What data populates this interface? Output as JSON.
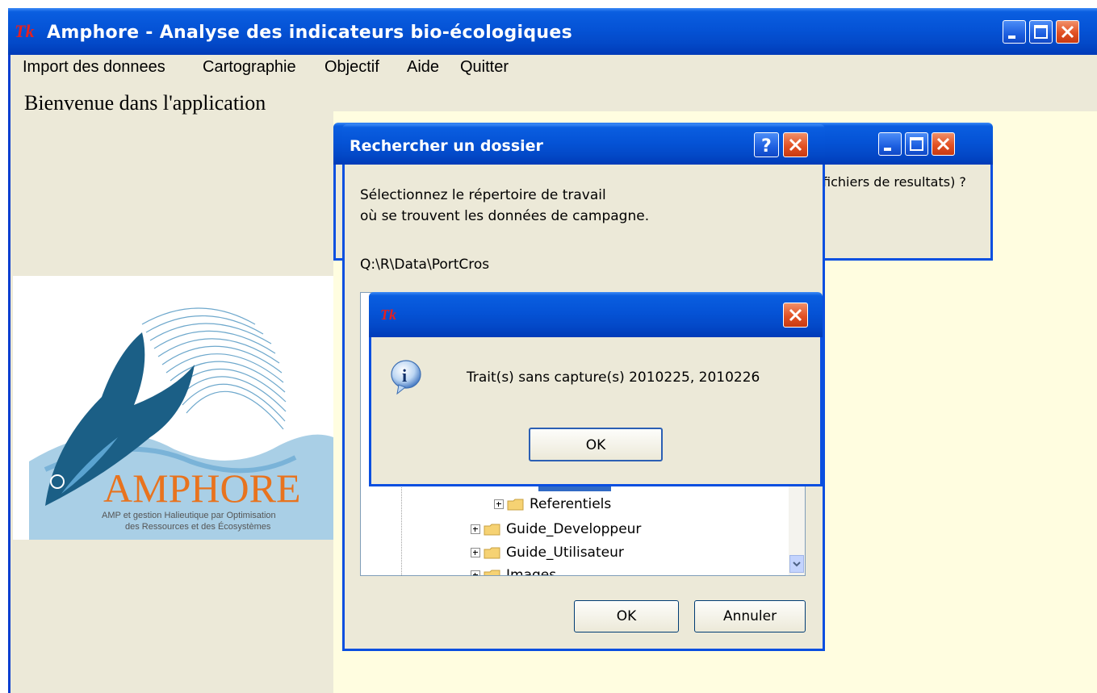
{
  "main_window": {
    "title": "Amphore - Analyse des indicateurs bio-écologiques",
    "app_icon_text": "Tk",
    "menu": [
      "Import des donnees",
      "Cartographie",
      "Objectif",
      "Aide",
      "Quitter"
    ],
    "welcome": "Bienvenue dans l'application"
  },
  "logo": {
    "name": "AMPHORE",
    "tagline_line1": "AMP et gestion Halieutique par Optimisation",
    "tagline_line2": "des Ressources et des Écosystèmes"
  },
  "background_dialog": {
    "partial_text": "fichiers de resultats) ?"
  },
  "browse_dialog": {
    "title": "Rechercher un dossier",
    "instruction_line1": "Sélectionnez le répertoire de travail",
    "instruction_line2": "où se trouvent les données de campagne.",
    "path": "Q:\\R\\Data\\PortCros",
    "tree": [
      {
        "label": "Referentiels",
        "level": 2
      },
      {
        "label": "Guide_Developpeur",
        "level": 1
      },
      {
        "label": "Guide_Utilisateur",
        "level": 1
      },
      {
        "label": "Images",
        "level": 1
      }
    ],
    "ok_label": "OK",
    "cancel_label": "Annuler"
  },
  "message_box": {
    "icon_text": "Tk",
    "message": "Trait(s) sans capture(s) 2010225, 2010226",
    "ok_label": "OK"
  },
  "colors": {
    "titlebar": "#0553d6",
    "window_bg": "#ece9d8",
    "content_bg": "#fffde0",
    "close_red": "#e25124"
  }
}
